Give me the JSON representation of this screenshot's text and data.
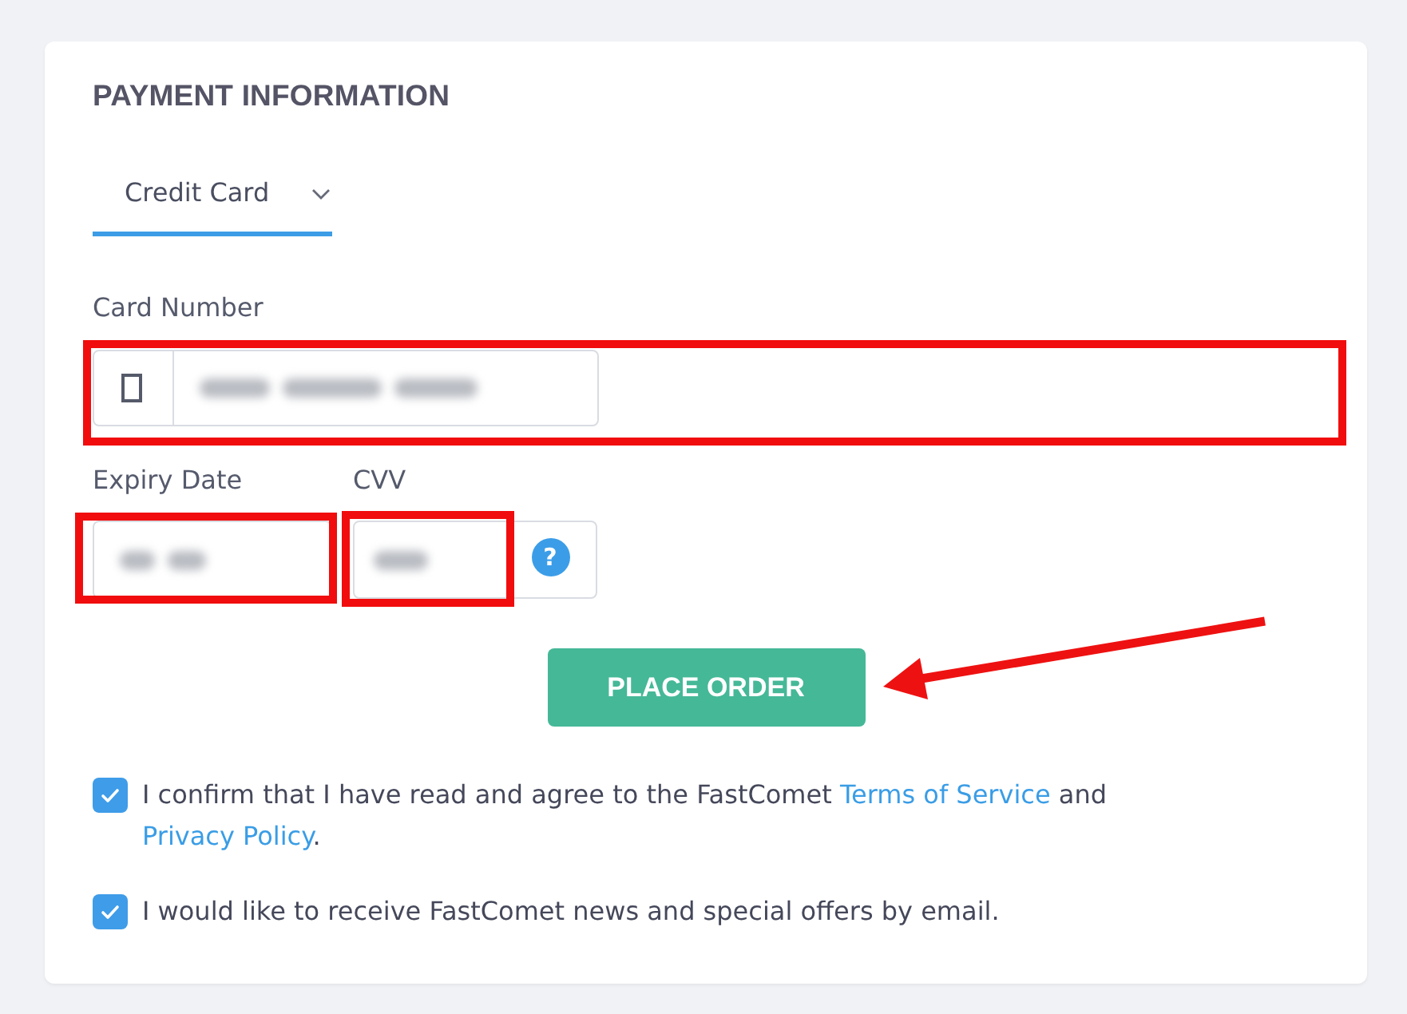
{
  "section_title": "PAYMENT INFORMATION",
  "payment_method": {
    "value": "Credit Card"
  },
  "card_number": {
    "label": "Card Number",
    "blurred": true,
    "highlighted": true
  },
  "expiry_date": {
    "label": "Expiry Date",
    "blurred": true,
    "highlighted": true
  },
  "cvv": {
    "label": "CVV",
    "blurred": true,
    "highlighted": true,
    "help_icon": "?"
  },
  "place_order_button": {
    "label": "PLACE ORDER",
    "pointed_at": true
  },
  "consents": [
    {
      "checked": true,
      "parts": [
        {
          "kind": "text",
          "text": "I confirm that I have read and agree to the FastComet "
        },
        {
          "kind": "link",
          "text": "Terms of Service"
        },
        {
          "kind": "text",
          "text": " and "
        },
        {
          "kind": "link",
          "text": "Privacy Policy"
        },
        {
          "kind": "text",
          "text": "."
        }
      ]
    },
    {
      "checked": true,
      "parts": [
        {
          "kind": "text",
          "text": "I would like to receive FastComet news and special offers by email."
        }
      ]
    }
  ]
}
